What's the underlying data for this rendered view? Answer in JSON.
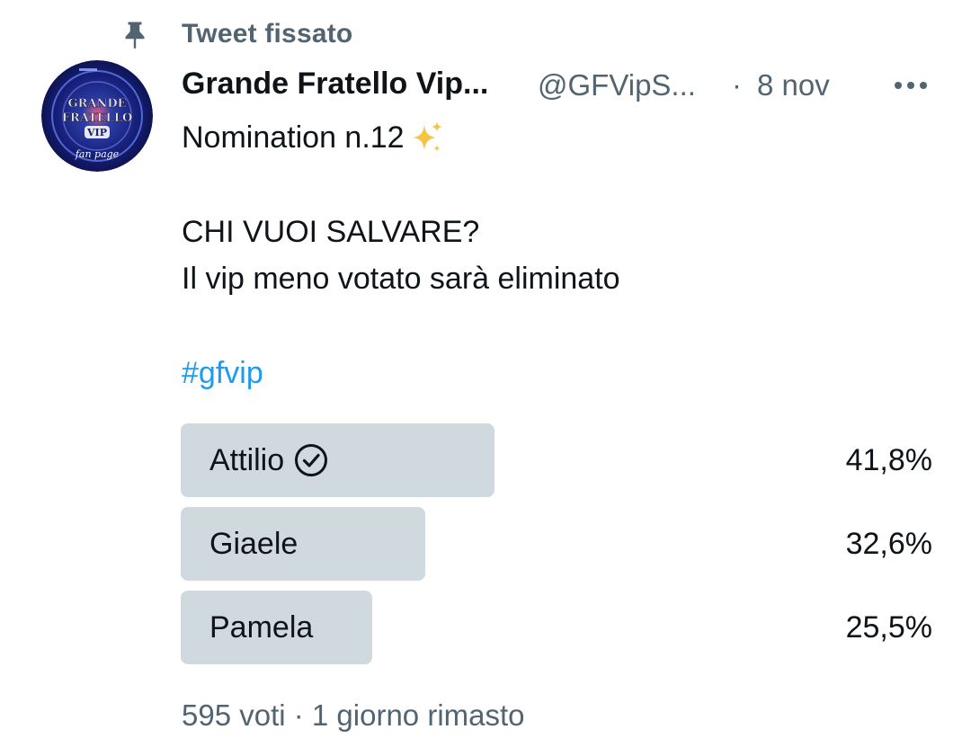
{
  "pinned": {
    "label": "Tweet fissato",
    "icon": "pin-icon"
  },
  "avatar": {
    "icon": "grande-fratello-vip-logo",
    "line1": "GRANDE",
    "line2": "FRATELLO",
    "line3": "VIP",
    "tagline": "fan page"
  },
  "tweet": {
    "author_name": "Grande Fratello Vip...",
    "author_handle": "@GFVipS...",
    "separator": "·",
    "date": "8 nov",
    "more_icon": "more-horizontal-icon",
    "text_line1": "Nomination n.12",
    "text_line2": "CHI VUOI SALVARE?",
    "text_line3": "Il vip meno votato sarà eliminato",
    "hashtag": "#gfvip"
  },
  "poll": {
    "bar_color": "#cfd9de",
    "options": [
      {
        "label": "Attilio",
        "percent": "41,8%",
        "value": 41.8,
        "winner": true
      },
      {
        "label": "Giaele",
        "percent": "32,6%",
        "value": 32.6,
        "winner": false
      },
      {
        "label": "Pamela",
        "percent": "25,5%",
        "value": 25.5,
        "winner": false
      }
    ],
    "footer": "595 voti · 1 giorno rimasto"
  },
  "colors": {
    "link": "#1d9bf0",
    "secondary": "#536471",
    "text": "#0f1419"
  }
}
